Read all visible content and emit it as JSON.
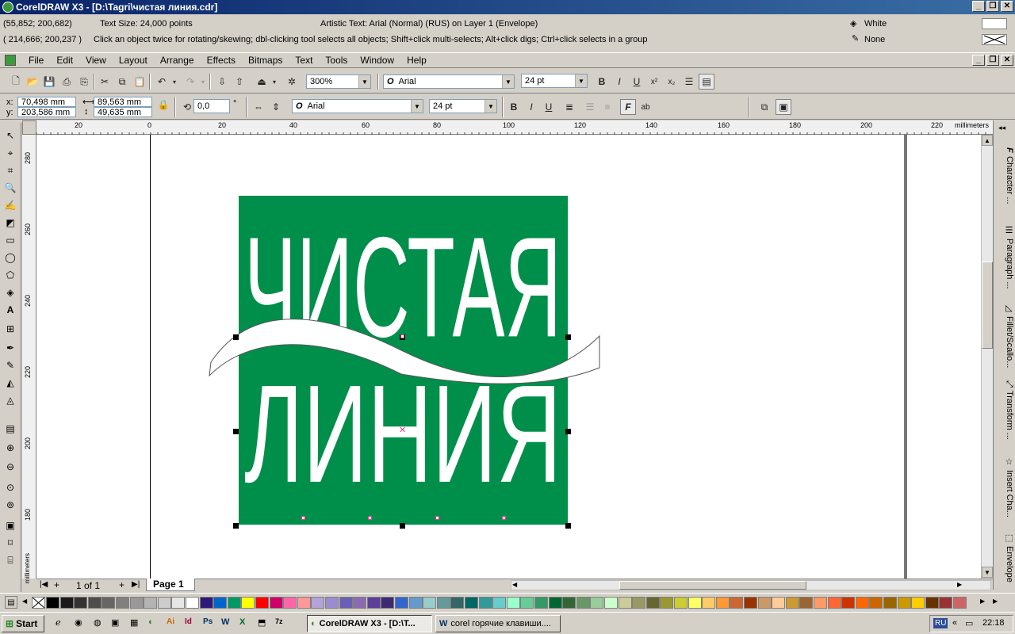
{
  "window": {
    "title": "CorelDRAW X3 - [D:\\Tagri\\чистая линия.cdr]",
    "min": "_",
    "restore": "❐",
    "close": "✕"
  },
  "info": {
    "coords1": "(55,852; 200,682)",
    "text_size": "Text Size: 24,000 points",
    "object_desc": "Artistic Text: Arial (Normal) (RUS) on Layer 1  (Envelope)",
    "coords2": "( 214,666; 200,237 )",
    "hint": "Click an object twice for rotating/skewing; dbl-clicking tool selects all objects; Shift+click multi-selects; Alt+click digs; Ctrl+click selects in a group",
    "fill_label": "White",
    "outline_label": "None"
  },
  "menu": [
    "File",
    "Edit",
    "View",
    "Layout",
    "Arrange",
    "Effects",
    "Bitmaps",
    "Text",
    "Tools",
    "Window",
    "Help"
  ],
  "toolbar1": {
    "zoom": "300%",
    "font": "Arial",
    "size": "24 pt"
  },
  "propbar": {
    "x": "70,498 mm",
    "y": "203,586 mm",
    "w": "89,563 mm",
    "h": "49,635 mm",
    "angle": "0,0",
    "degree": "°",
    "font": "Arial",
    "size": "24 pt"
  },
  "ruler": {
    "h_ticks": [
      "20",
      "0",
      "20",
      "40",
      "60",
      "80",
      "100",
      "120",
      "140",
      "160",
      "180",
      "200",
      "220"
    ],
    "unit": "millimeters",
    "v_ticks": [
      "280",
      "260",
      "240",
      "220",
      "200",
      "180"
    ],
    "v_unit": "millimeters"
  },
  "artwork": {
    "line1": "ЧИСТАЯ",
    "line2": "ЛИНИЯ",
    "bg_color": "#008f4a"
  },
  "dockers": [
    "Character ...",
    "Paragraph ...",
    "Fillet/Scallo...",
    "Transform ...",
    "Insert Cha...",
    "Envelope"
  ],
  "pagenav": {
    "counter": "1 of 1",
    "page_tab": "Page 1"
  },
  "palette": [
    "#000000",
    "#1a1a1a",
    "#333333",
    "#4d4d4d",
    "#666666",
    "#808080",
    "#999999",
    "#b3b3b3",
    "#cccccc",
    "#e6e6e6",
    "#ffffff",
    "#2e1a7a",
    "#0066cc",
    "#009966",
    "#ffff00",
    "#ff0000",
    "#cc0066",
    "#ff66aa",
    "#ff9999",
    "#b3a3d9",
    "#9a8ccf",
    "#6b5fb5",
    "#8c6bb3",
    "#5b3f99",
    "#3d2a73",
    "#3366cc",
    "#6699cc",
    "#99cccc",
    "#669999",
    "#336666",
    "#006666",
    "#339999",
    "#66cccc",
    "#99ffcc",
    "#66cc99",
    "#339966",
    "#006633",
    "#336633",
    "#669966",
    "#99cc99",
    "#ccffcc",
    "#cccc99",
    "#999966",
    "#666633",
    "#999933",
    "#cccc33",
    "#ffff66",
    "#ffcc66",
    "#ff9933",
    "#cc6633",
    "#993300",
    "#cc9966",
    "#ffcc99",
    "#cc9933",
    "#996633",
    "#ff9966",
    "#ff6633",
    "#cc3300",
    "#ff6600",
    "#cc6600",
    "#996600",
    "#cc9900",
    "#ffcc00",
    "#663300",
    "#993333",
    "#cc6666"
  ],
  "taskbar": {
    "start": "Start",
    "task1": "CorelDRAW X3 - [D:\\T...",
    "task2": "corel горячие клавиши....",
    "lang": "RU",
    "time": "22:18"
  }
}
